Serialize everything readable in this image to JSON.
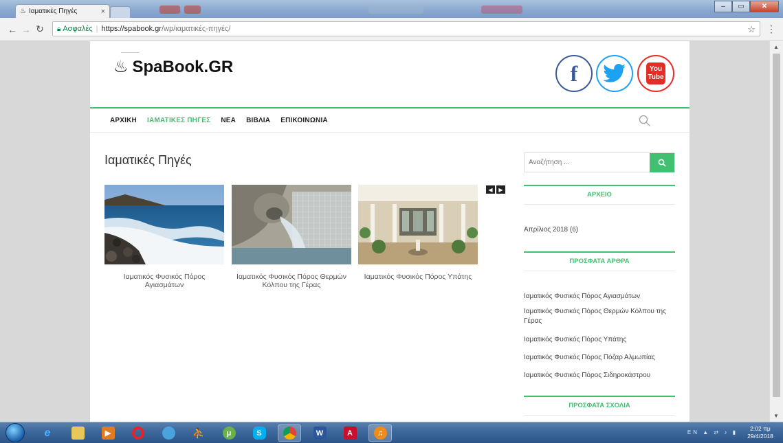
{
  "browser": {
    "tab_title": "Ιαματικές Πηγές",
    "tab_close": "×",
    "secure_label": "Ασφαλές",
    "url_host": "https://spabook.gr",
    "url_path": "/wp/ιαματικές-πηγές/"
  },
  "site": {
    "logo_text": "SpaBook.GR",
    "logo_icon": "spa-steam-icon",
    "social": {
      "facebook": "f",
      "youtube_top": "You",
      "youtube_bottom": "Tube"
    },
    "nav": [
      "ΑΡΧΙΚΗ",
      "ΙΑΜΑΤΙΚΕΣ ΠΗΓΕΣ",
      "ΝΕΑ",
      "ΒΙΒΛΙΑ",
      "ΕΠΙΚΟΙΝΩΝΙΑ"
    ],
    "active_nav": "ΙΑΜΑΤΙΚΕΣ ΠΗΓΕΣ",
    "accent_color": "#42c071"
  },
  "main": {
    "title": "Ιαματικές Πηγές",
    "cards": [
      {
        "caption": "Ιαματικός Φυσικός Πόρος Αγιασμάτων",
        "image": "rocky-sea-shore"
      },
      {
        "caption": "Ιαματικός Φυσικός Πόρος Θερμών Κόλπου της Γέρας",
        "image": "stone-fountain-water"
      },
      {
        "caption": "Ιαματικός Φυσικός Πόρος Υπάτης",
        "image": "spa-courtyard"
      }
    ],
    "slider_prev": "◀",
    "slider_next": "▶"
  },
  "sidebar": {
    "search_placeholder": "Αναζήτηση ...",
    "archive_heading": "ΑΡΧΕΙΟ",
    "archive_item": "Απρίλιος 2018 (6)",
    "recent_posts_heading": "ΠΡΟΣΦΑΤΑ ΑΡΘΡΑ",
    "recent_posts": [
      "Ιαματικός Φυσικός Πόρος Αγιασμάτων",
      "Ιαματικός Φυσικός Πόρος Θερμών Κόλπου της Γέρας",
      "Ιαματικός Φυσικός Πόρος Υπάτης",
      "Ιαματικός Φυσικός Πόρος Πόζαρ Αλμωπίας",
      "Ιαματικός Φυσικός Πόρος Σιδηροκάστρου"
    ],
    "recent_comments_heading": "ΠΡΟΣΦΑΤΑ ΣΧΟΛΙΑ"
  },
  "taskbar": {
    "language": "EN",
    "time": "2:02 πμ",
    "date": "29/4/2018"
  }
}
